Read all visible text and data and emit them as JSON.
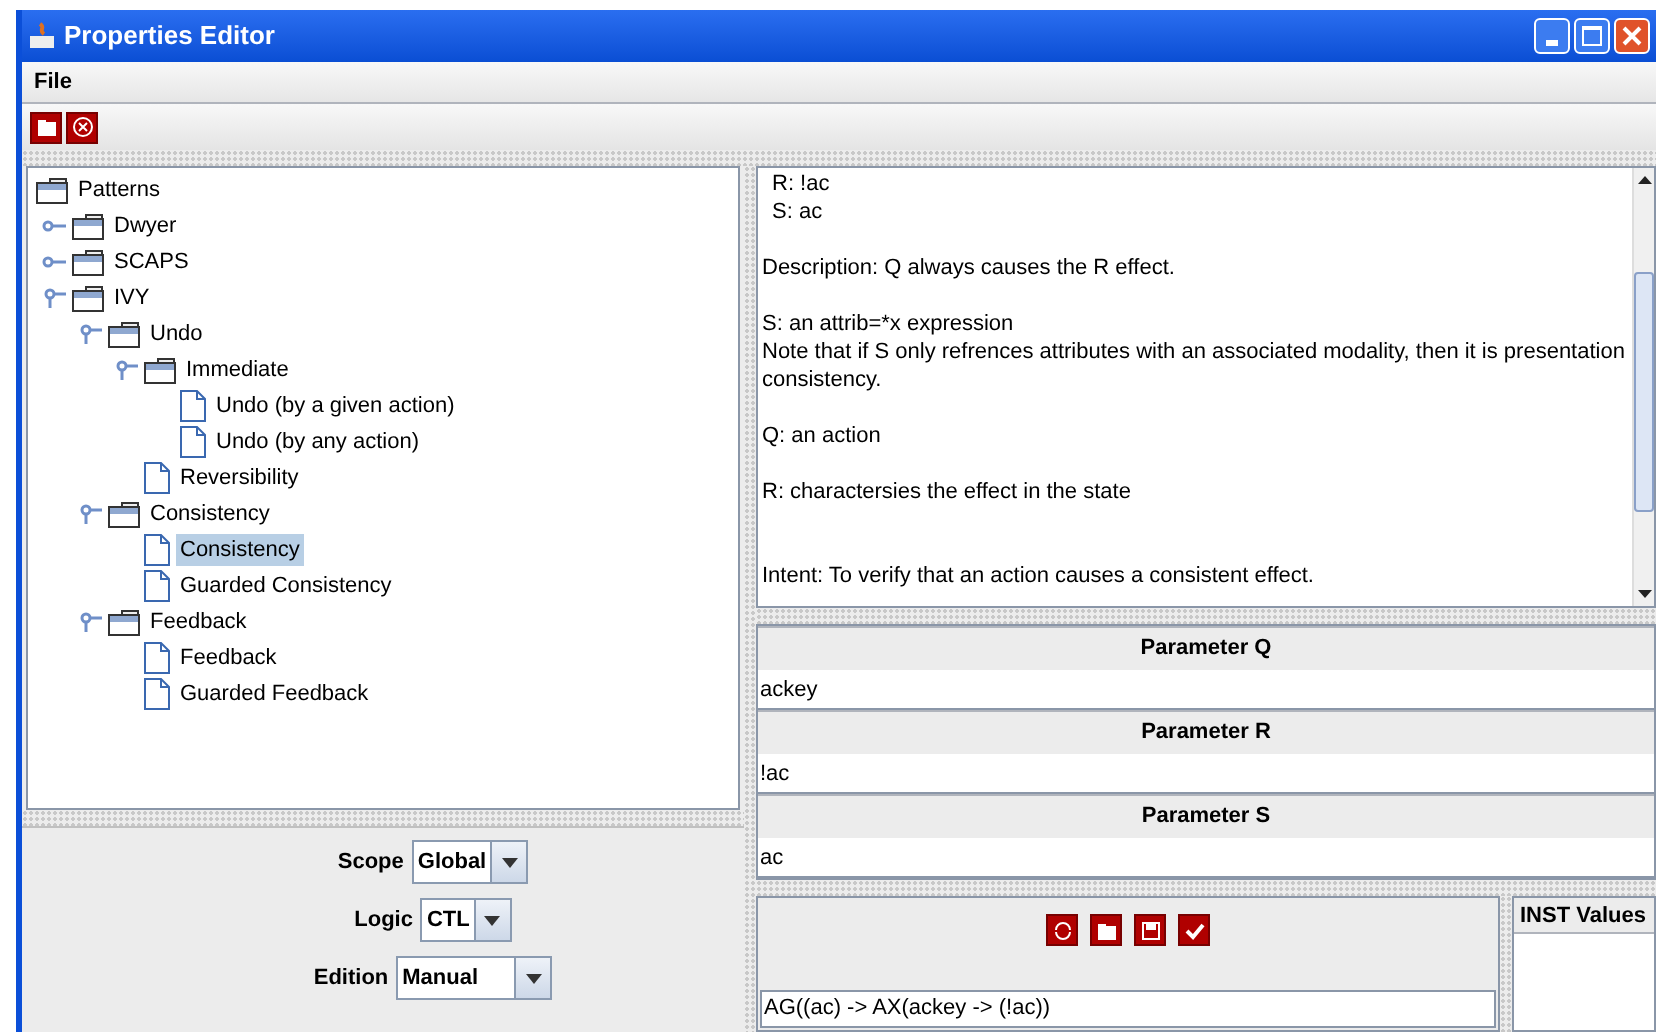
{
  "window": {
    "title": "Properties Editor"
  },
  "menu": [
    "File"
  ],
  "tree": {
    "label": "Patterns",
    "kind": "folder",
    "selected": false,
    "children": [
      {
        "label": "Dwyer",
        "kind": "folder",
        "expanded": false,
        "selected": false
      },
      {
        "label": "SCAPS",
        "kind": "folder",
        "expanded": false,
        "selected": false
      },
      {
        "label": "IVY",
        "kind": "folder",
        "expanded": true,
        "selected": false,
        "children": [
          {
            "label": "Undo",
            "kind": "folder",
            "expanded": true,
            "selected": false,
            "children": [
              {
                "label": "Immediate",
                "kind": "folder",
                "expanded": true,
                "selected": false,
                "children": [
                  {
                    "label": "Undo (by a given action)",
                    "kind": "leaf",
                    "selected": false
                  },
                  {
                    "label": "Undo (by any action)",
                    "kind": "leaf",
                    "selected": false
                  }
                ]
              },
              {
                "label": "Reversibility",
                "kind": "leaf",
                "selected": false
              }
            ]
          },
          {
            "label": "Consistency",
            "kind": "folder",
            "expanded": true,
            "selected": false,
            "children": [
              {
                "label": "Consistency",
                "kind": "leaf",
                "selected": true
              },
              {
                "label": "Guarded Consistency",
                "kind": "leaf",
                "selected": false
              }
            ]
          },
          {
            "label": "Feedback",
            "kind": "folder",
            "expanded": true,
            "selected": false,
            "children": [
              {
                "label": "Feedback",
                "kind": "leaf",
                "selected": false
              },
              {
                "label": "Guarded Feedback",
                "kind": "leaf",
                "selected": false
              }
            ]
          }
        ]
      }
    ]
  },
  "options": [
    {
      "label": "Scope",
      "value": "Global"
    },
    {
      "label": "Logic",
      "value": "CTL"
    },
    {
      "label": "Edition",
      "value": "Manual"
    }
  ],
  "description": [
    {
      "kind": "indented",
      "lines": [
        "R: !ac",
        "S: ac"
      ]
    },
    {
      "kind": "plain",
      "lines": [
        "Description: Q always causes the R effect."
      ]
    },
    {
      "kind": "plain",
      "lines": [
        "S: an attrib=*x expression",
        "Note that if S only refrences attributes with an associated modality, then it is presentation consistency."
      ]
    },
    {
      "kind": "plain",
      "lines": [
        "Q: an action"
      ]
    },
    {
      "kind": "plain",
      "lines": [
        "R: charactersies the effect in the state"
      ]
    },
    {
      "kind": "spaced",
      "lines": [
        "Intent: To verify that an action causes a consistent effect."
      ]
    }
  ],
  "parameters": [
    {
      "name": "Parameter Q",
      "value": "ackey"
    },
    {
      "name": "Parameter R",
      "value": "!ac"
    },
    {
      "name": "Parameter S",
      "value": "ac"
    }
  ],
  "formula": "AG((ac) -> AX(ackey -> (!ac))",
  "inst_values": {
    "title": "INST Values"
  }
}
